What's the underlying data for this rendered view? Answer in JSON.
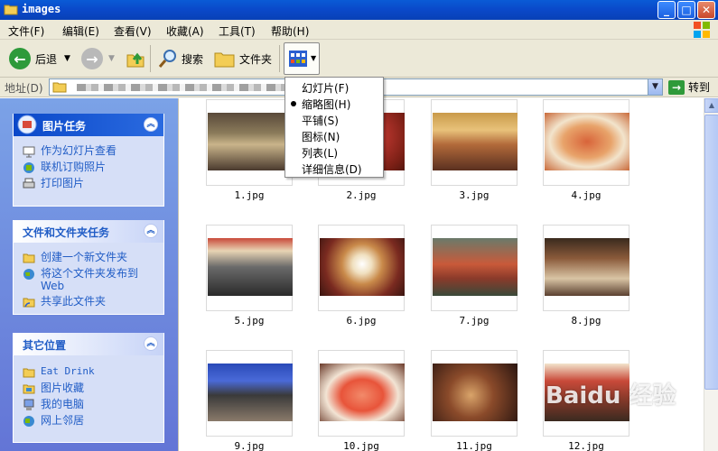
{
  "window": {
    "title": "images"
  },
  "menu": [
    "文件(F)",
    "编辑(E)",
    "查看(V)",
    "收藏(A)",
    "工具(T)",
    "帮助(H)"
  ],
  "toolbar": {
    "back": "后退",
    "search": "搜索",
    "folders": "文件夹"
  },
  "address": {
    "label": "地址(D)",
    "go": "转到"
  },
  "views_menu": {
    "items": [
      "幻灯片(F)",
      "缩略图(H)",
      "平铺(S)",
      "图标(N)",
      "列表(L)",
      "详细信息(D)"
    ],
    "selected": "缩略图(H)"
  },
  "panels": {
    "picture_tasks": {
      "title": "图片任务",
      "items": [
        "作为幻灯片查看",
        "联机订购照片",
        "打印图片"
      ]
    },
    "file_tasks": {
      "title": "文件和文件夹任务",
      "items": [
        "创建一个新文件夹",
        "将这个文件夹发布到 Web",
        "共享此文件夹"
      ]
    },
    "other_places": {
      "title": "其它位置",
      "items": [
        "Eat Drink",
        "图片收藏",
        "我的电脑",
        "网上邻居"
      ]
    }
  },
  "files": [
    "1.jpg",
    "2.jpg",
    "3.jpg",
    "4.jpg",
    "5.jpg",
    "6.jpg",
    "7.jpg",
    "8.jpg",
    "9.jpg",
    "10.jpg",
    "11.jpg",
    "12.jpg"
  ],
  "watermark": "Baidu 经验",
  "colors": {
    "title_blue": "#0a48c9",
    "task_link": "#215dc6",
    "pane_bg": "#6f8fe0"
  }
}
